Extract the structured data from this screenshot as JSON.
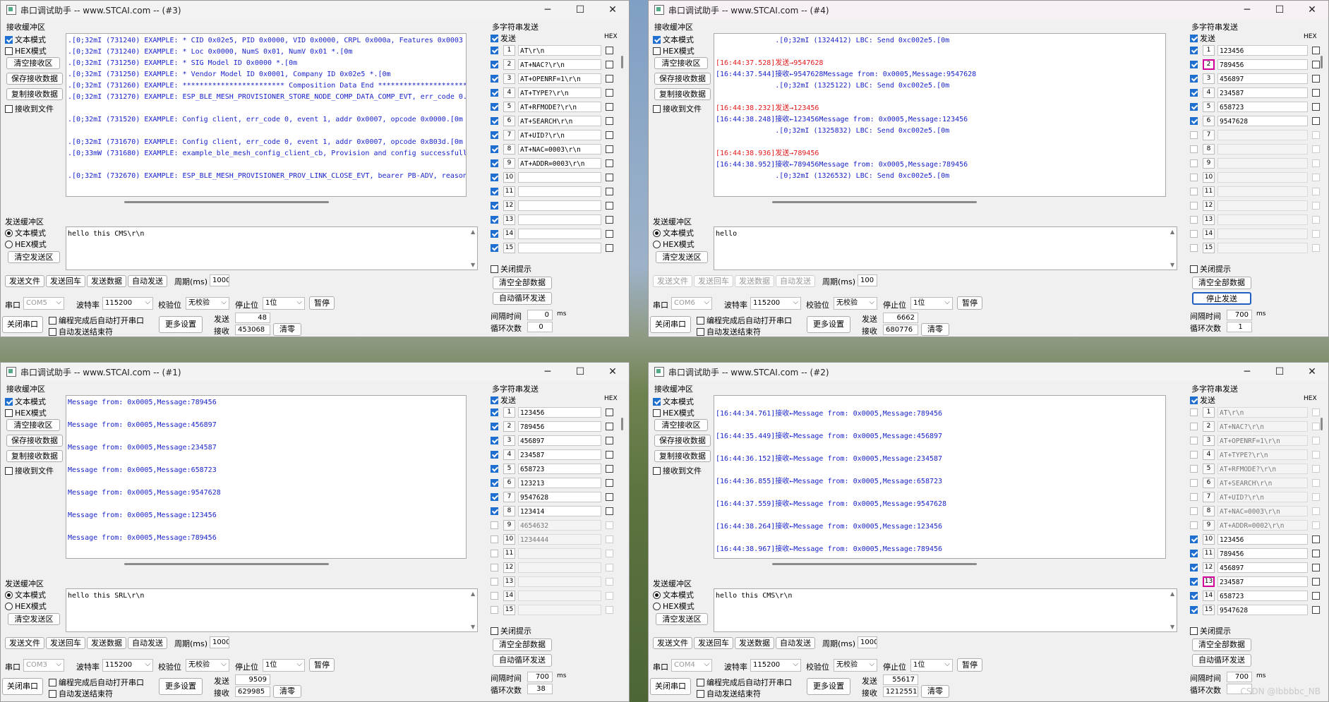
{
  "common": {
    "recv_title": "接收缓冲区",
    "text_mode": "文本模式",
    "hex_mode": "HEX模式",
    "clear_recv": "清空接收区",
    "save_recv": "保存接收数据",
    "copy_recv": "复制接收数据",
    "recv_to_file": "接收到文件",
    "send_title": "发送缓冲区",
    "clear_send": "清空发送区",
    "send_file": "发送文件",
    "send_enter": "发送回车",
    "send_data": "发送数据",
    "auto_send": "自动发送",
    "period_label": "周期(ms)",
    "port_label": "串口",
    "baud_label": "波特率",
    "baud": "115200",
    "parity_label": "校验位",
    "parity": "无校验",
    "stop_label": "停止位",
    "stop": "1位",
    "pause": "暂停",
    "close_port": "关闭串口",
    "auto_open": "编程完成后自动打开串口",
    "auto_send_end": "自动发送结束符",
    "more_settings": "更多设置",
    "sent_label": "发送",
    "recv_label": "接收",
    "clear_count": "清零",
    "multi_title": "多字符串发送",
    "send_col": "发送",
    "hex_col": "HEX",
    "close_hint": "关闭提示",
    "clear_all": "清空全部数据",
    "auto_loop": "自动循环发送",
    "stop_send": "停止发送",
    "interval_label": "间隔时间",
    "ms": "ms",
    "loop_count_label": "循环次数",
    "minimize": "─",
    "maximize": "☐",
    "close": "✕"
  },
  "windows": [
    {
      "title": "串口调试助手 -- www.STCAI.com -- (#3)",
      "log": [
        {
          "c": "blue",
          "t": ".[0;32mI (731240) EXAMPLE: * CID 0x02e5, PID 0x0000, VID 0x0000, CRPL 0x000a, Features 0x0003"
        },
        {
          "c": "blue",
          "t": ".[0;32mI (731240) EXAMPLE: * Loc 0x0000, NumS 0x01, NumV 0x01 *.[0m"
        },
        {
          "c": "blue",
          "t": ".[0;32mI (731250) EXAMPLE: * SIG Model ID 0x0000 *.[0m"
        },
        {
          "c": "blue",
          "t": ".[0;32mI (731250) EXAMPLE: * Vendor Model ID 0x0001, Company ID 0x02e5 *.[0m"
        },
        {
          "c": "blue",
          "t": ".[0;32mI (731260) EXAMPLE: ************************ Composition Data End ************************"
        },
        {
          "c": "blue",
          "t": ".[0;32mI (731270) EXAMPLE: ESP_BLE_MESH_PROVISIONER_STORE_NODE_COMP_DATA_COMP_EVT, err_code 0."
        },
        {
          "c": "blue",
          "t": ""
        },
        {
          "c": "blue",
          "t": ".[0;32mI (731520) EXAMPLE: Config client, err_code 0, event 1, addr 0x0007, opcode 0x0000.[0m"
        },
        {
          "c": "blue",
          "t": ""
        },
        {
          "c": "blue",
          "t": ".[0;32mI (731670) EXAMPLE: Config client, err_code 0, event 1, addr 0x0007, opcode 0x803d.[0m"
        },
        {
          "c": "blue",
          "t": ".[0;33mW (731680) EXAMPLE: example_ble_mesh_config_client_cb, Provision and config successfull"
        },
        {
          "c": "blue",
          "t": ""
        },
        {
          "c": "blue",
          "t": ".[0;32mI (732670) EXAMPLE: ESP_BLE_MESH_PROVISIONER_PROV_LINK_CLOSE_EVT, bearer PB-ADV, reason"
        }
      ],
      "send_text": "hello this CMS\\r\\n",
      "period": "1000",
      "port": "COM5",
      "sent": "48",
      "received": "453068",
      "interval": "0",
      "loop_count": "0",
      "loop_button": "自动循环发送",
      "rows": [
        {
          "n": "1",
          "v": "AT\\r\\n",
          "on": true,
          "dis": false,
          "hl": false
        },
        {
          "n": "2",
          "v": "AT+NAC?\\r\\n",
          "on": true,
          "dis": false,
          "hl": false
        },
        {
          "n": "3",
          "v": "AT+OPENRF=1\\r\\n",
          "on": true,
          "dis": false,
          "hl": false
        },
        {
          "n": "4",
          "v": "AT+TYPE?\\r\\n",
          "on": true,
          "dis": false,
          "hl": false
        },
        {
          "n": "5",
          "v": "AT+RFMODE?\\r\\n",
          "on": true,
          "dis": false,
          "hl": false
        },
        {
          "n": "6",
          "v": "AT+SEARCH\\r\\n",
          "on": true,
          "dis": false,
          "hl": false
        },
        {
          "n": "7",
          "v": "AT+UID?\\r\\n",
          "on": true,
          "dis": false,
          "hl": false
        },
        {
          "n": "8",
          "v": "AT+NAC=0003\\r\\n",
          "on": true,
          "dis": false,
          "hl": false
        },
        {
          "n": "9",
          "v": "AT+ADDR=0003\\r\\n",
          "on": true,
          "dis": false,
          "hl": false
        },
        {
          "n": "10",
          "v": "",
          "on": true,
          "dis": false,
          "hl": false
        },
        {
          "n": "11",
          "v": "",
          "on": true,
          "dis": false,
          "hl": false
        },
        {
          "n": "12",
          "v": "",
          "on": true,
          "dis": false,
          "hl": false
        },
        {
          "n": "13",
          "v": "",
          "on": true,
          "dis": false,
          "hl": false
        },
        {
          "n": "14",
          "v": "",
          "on": true,
          "dis": false,
          "hl": false
        },
        {
          "n": "15",
          "v": "",
          "on": true,
          "dis": false,
          "hl": false
        }
      ]
    },
    {
      "title": "串口调试助手 -- www.STCAI.com -- (#4)",
      "log": [
        {
          "c": "blue",
          "t": "              .[0;32mI (1324412) LBC: Send 0xc002e5.[0m"
        },
        {
          "c": "blue",
          "t": ""
        },
        {
          "c": "red",
          "t": "[16:44:37.528]发送→9547628"
        },
        {
          "c": "blue",
          "t": "[16:44:37.544]接收←9547628Message from: 0x0005,Message:9547628"
        },
        {
          "c": "blue",
          "t": "              .[0;32mI (1325122) LBC: Send 0xc002e5.[0m"
        },
        {
          "c": "blue",
          "t": ""
        },
        {
          "c": "red",
          "t": "[16:44:38.232]发送→123456"
        },
        {
          "c": "blue",
          "t": "[16:44:38.248]接收←123456Message from: 0x0005,Message:123456"
        },
        {
          "c": "blue",
          "t": "              .[0;32mI (1325832) LBC: Send 0xc002e5.[0m"
        },
        {
          "c": "blue",
          "t": ""
        },
        {
          "c": "red",
          "t": "[16:44:38.936]发送→789456"
        },
        {
          "c": "blue",
          "t": "[16:44:38.952]接收←789456Message from: 0x0005,Message:789456"
        },
        {
          "c": "blue",
          "t": "              .[0;32mI (1326532) LBC: Send 0xc002e5.[0m"
        }
      ],
      "send_text": "hello",
      "period": "100",
      "port": "COM6",
      "sent": "6662",
      "received": "680776",
      "interval": "700",
      "loop_count": "1",
      "loop_button": "停止发送",
      "rows": [
        {
          "n": "1",
          "v": "123456",
          "on": true,
          "dis": false,
          "hl": false
        },
        {
          "n": "2",
          "v": "789456",
          "on": true,
          "dis": false,
          "hl": true
        },
        {
          "n": "3",
          "v": "456897",
          "on": true,
          "dis": false,
          "hl": false
        },
        {
          "n": "4",
          "v": "234587",
          "on": true,
          "dis": false,
          "hl": false
        },
        {
          "n": "5",
          "v": "658723",
          "on": true,
          "dis": false,
          "hl": false
        },
        {
          "n": "6",
          "v": "9547628",
          "on": true,
          "dis": false,
          "hl": false
        },
        {
          "n": "7",
          "v": "",
          "on": false,
          "dis": true,
          "hl": false
        },
        {
          "n": "8",
          "v": "",
          "on": false,
          "dis": true,
          "hl": false
        },
        {
          "n": "9",
          "v": "",
          "on": false,
          "dis": true,
          "hl": false
        },
        {
          "n": "10",
          "v": "",
          "on": false,
          "dis": true,
          "hl": false
        },
        {
          "n": "11",
          "v": "",
          "on": false,
          "dis": true,
          "hl": false
        },
        {
          "n": "12",
          "v": "",
          "on": false,
          "dis": true,
          "hl": false
        },
        {
          "n": "13",
          "v": "",
          "on": false,
          "dis": true,
          "hl": false
        },
        {
          "n": "14",
          "v": "",
          "on": false,
          "dis": true,
          "hl": false
        },
        {
          "n": "15",
          "v": "",
          "on": false,
          "dis": true,
          "hl": false
        }
      ]
    },
    {
      "title": "串口调试助手 -- www.STCAI.com -- (#1)",
      "log": [
        {
          "c": "blue",
          "t": "Message from: 0x0005,Message:789456"
        },
        {
          "c": "blue",
          "t": ""
        },
        {
          "c": "blue",
          "t": "Message from: 0x0005,Message:456897"
        },
        {
          "c": "blue",
          "t": ""
        },
        {
          "c": "blue",
          "t": "Message from: 0x0005,Message:234587"
        },
        {
          "c": "blue",
          "t": ""
        },
        {
          "c": "blue",
          "t": "Message from: 0x0005,Message:658723"
        },
        {
          "c": "blue",
          "t": ""
        },
        {
          "c": "blue",
          "t": "Message from: 0x0005,Message:9547628"
        },
        {
          "c": "blue",
          "t": ""
        },
        {
          "c": "blue",
          "t": "Message from: 0x0005,Message:123456"
        },
        {
          "c": "blue",
          "t": ""
        },
        {
          "c": "blue",
          "t": "Message from: 0x0005,Message:789456"
        }
      ],
      "send_text": "hello this SRL\\r\\n",
      "period": "1000",
      "port": "COM3",
      "sent": "9509",
      "received": "629985",
      "interval": "700",
      "loop_count": "38",
      "loop_button": "自动循环发送",
      "rows": [
        {
          "n": "1",
          "v": "123456",
          "on": true,
          "dis": false,
          "hl": false
        },
        {
          "n": "2",
          "v": "789456",
          "on": true,
          "dis": false,
          "hl": false
        },
        {
          "n": "3",
          "v": "456897",
          "on": true,
          "dis": false,
          "hl": false
        },
        {
          "n": "4",
          "v": "234587",
          "on": true,
          "dis": false,
          "hl": false
        },
        {
          "n": "5",
          "v": "658723",
          "on": true,
          "dis": false,
          "hl": false
        },
        {
          "n": "6",
          "v": "123213",
          "on": true,
          "dis": false,
          "hl": false
        },
        {
          "n": "7",
          "v": "9547628",
          "on": true,
          "dis": false,
          "hl": false
        },
        {
          "n": "8",
          "v": "123414",
          "on": true,
          "dis": false,
          "hl": false
        },
        {
          "n": "9",
          "v": "4654632",
          "on": false,
          "dis": true,
          "hl": false
        },
        {
          "n": "10",
          "v": "1234444",
          "on": false,
          "dis": true,
          "hl": false
        },
        {
          "n": "11",
          "v": "",
          "on": false,
          "dis": true,
          "hl": false
        },
        {
          "n": "12",
          "v": "",
          "on": false,
          "dis": true,
          "hl": false
        },
        {
          "n": "13",
          "v": "",
          "on": false,
          "dis": true,
          "hl": false
        },
        {
          "n": "14",
          "v": "",
          "on": false,
          "dis": true,
          "hl": false
        },
        {
          "n": "15",
          "v": "",
          "on": false,
          "dis": true,
          "hl": false
        }
      ]
    },
    {
      "title": "串口调试助手 -- www.STCAI.com -- (#2)",
      "log": [
        {
          "c": "blue",
          "t": ""
        },
        {
          "c": "blue",
          "t": "[16:44:34.761]接收←Message from: 0x0005,Message:789456"
        },
        {
          "c": "blue",
          "t": ""
        },
        {
          "c": "blue",
          "t": "[16:44:35.449]接收←Message from: 0x0005,Message:456897"
        },
        {
          "c": "blue",
          "t": ""
        },
        {
          "c": "blue",
          "t": "[16:44:36.152]接收←Message from: 0x0005,Message:234587"
        },
        {
          "c": "blue",
          "t": ""
        },
        {
          "c": "blue",
          "t": "[16:44:36.855]接收←Message from: 0x0005,Message:658723"
        },
        {
          "c": "blue",
          "t": ""
        },
        {
          "c": "blue",
          "t": "[16:44:37.559]接收←Message from: 0x0005,Message:9547628"
        },
        {
          "c": "blue",
          "t": ""
        },
        {
          "c": "blue",
          "t": "[16:44:38.264]接收←Message from: 0x0005,Message:123456"
        },
        {
          "c": "blue",
          "t": ""
        },
        {
          "c": "blue",
          "t": "[16:44:38.967]接收←Message from: 0x0005,Message:789456"
        }
      ],
      "send_text": "hello this CMS\\r\\n",
      "period": "1000",
      "port": "COM4",
      "sent": "55617",
      "received": "1212551",
      "interval": "700",
      "loop_count": "",
      "loop_button": "自动循环发送",
      "rows": [
        {
          "n": "1",
          "v": "AT\\r\\n",
          "on": false,
          "dis": true,
          "hl": false
        },
        {
          "n": "2",
          "v": "AT+NAC?\\r\\n",
          "on": false,
          "dis": true,
          "hl": false
        },
        {
          "n": "3",
          "v": "AT+OPENRF=1\\r\\n",
          "on": false,
          "dis": true,
          "hl": false
        },
        {
          "n": "4",
          "v": "AT+TYPE?\\r\\n",
          "on": false,
          "dis": true,
          "hl": false
        },
        {
          "n": "5",
          "v": "AT+RFMODE?\\r\\n",
          "on": false,
          "dis": true,
          "hl": false
        },
        {
          "n": "6",
          "v": "AT+SEARCH\\r\\n",
          "on": false,
          "dis": true,
          "hl": false
        },
        {
          "n": "7",
          "v": "AT+UID?\\r\\n",
          "on": false,
          "dis": true,
          "hl": false
        },
        {
          "n": "8",
          "v": "AT+NAC=0003\\r\\n",
          "on": false,
          "dis": true,
          "hl": false
        },
        {
          "n": "9",
          "v": "AT+ADDR=0002\\r\\n",
          "on": false,
          "dis": true,
          "hl": false
        },
        {
          "n": "10",
          "v": "123456",
          "on": true,
          "dis": false,
          "hl": false
        },
        {
          "n": "11",
          "v": "789456",
          "on": true,
          "dis": false,
          "hl": false
        },
        {
          "n": "12",
          "v": "456897",
          "on": true,
          "dis": false,
          "hl": false
        },
        {
          "n": "13",
          "v": "234587",
          "on": true,
          "dis": false,
          "hl": true
        },
        {
          "n": "14",
          "v": "658723",
          "on": true,
          "dis": false,
          "hl": false
        },
        {
          "n": "15",
          "v": "9547628",
          "on": true,
          "dis": false,
          "hl": false
        }
      ]
    }
  ],
  "watermark": "CSDN @lbbbbc_NB"
}
